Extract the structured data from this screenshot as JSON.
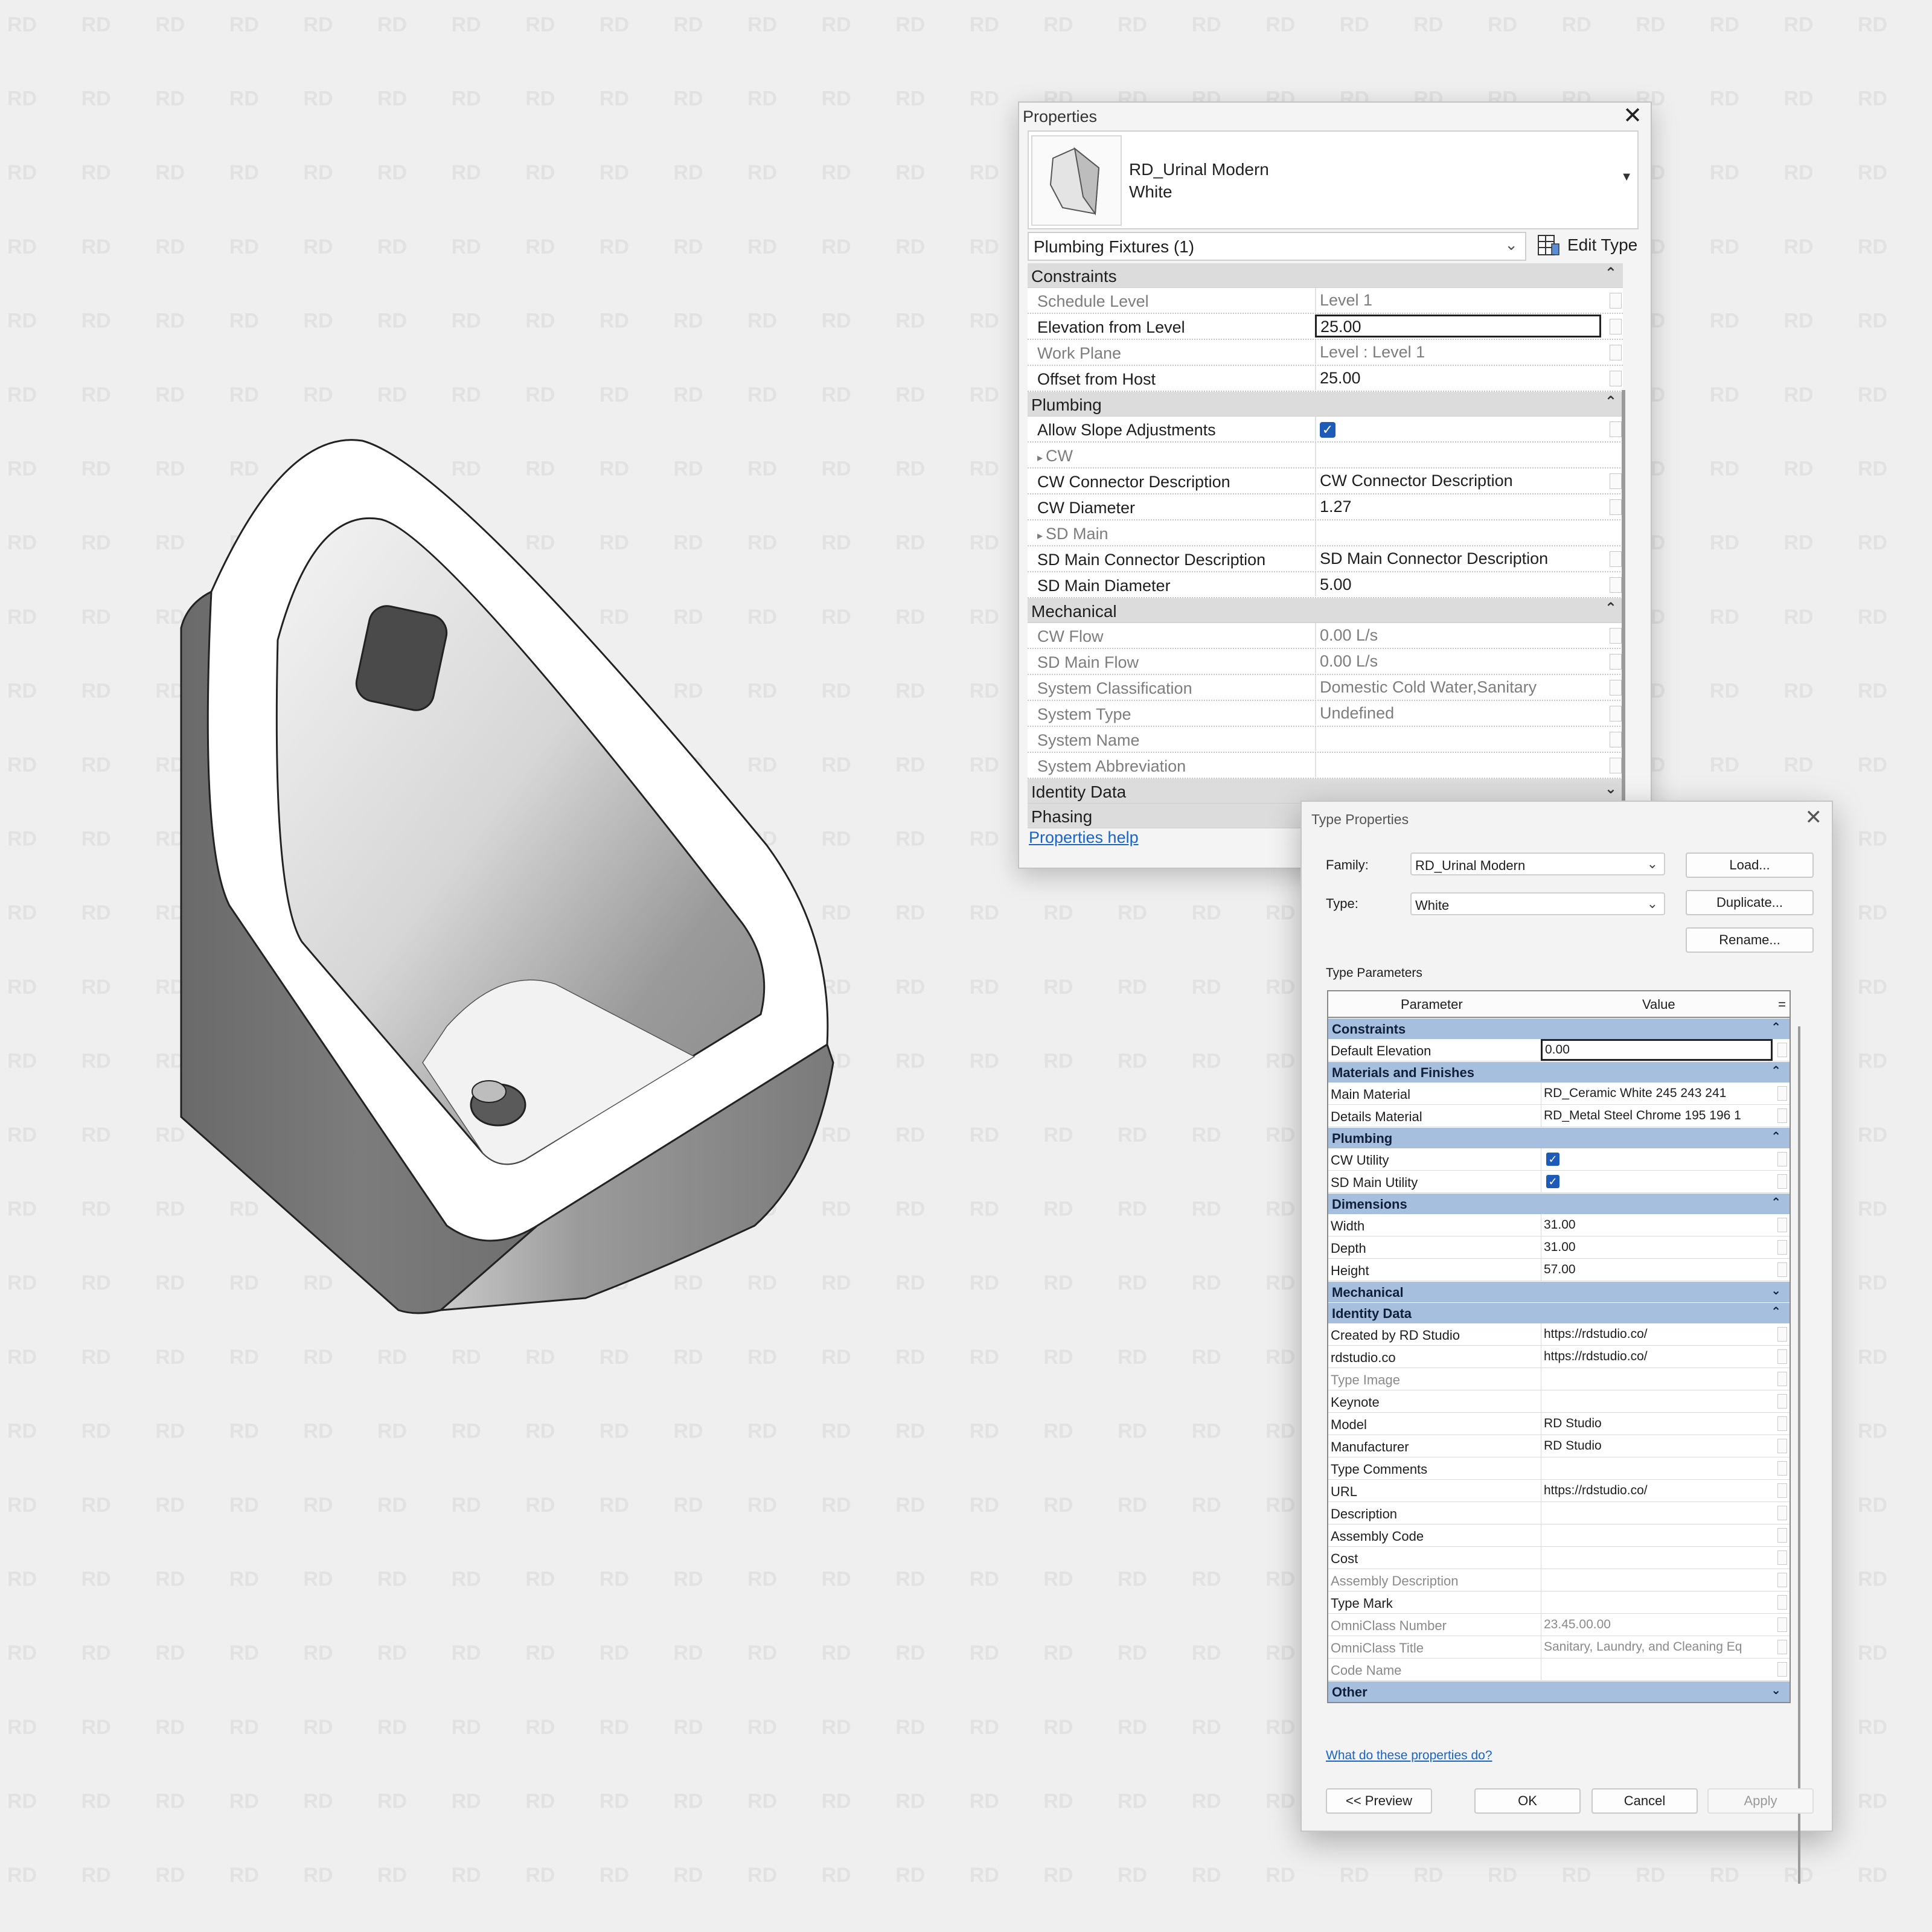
{
  "watermark": {
    "text": "RD"
  },
  "properties": {
    "title": "Properties",
    "close_icon": "close-icon",
    "type_selector": {
      "family": "RD_Urinal Modern",
      "type": "White"
    },
    "filter": "Plumbing Fixtures (1)",
    "edit_type_label": "Edit Type",
    "groups": [
      {
        "name": "Constraints",
        "expanded": true,
        "rows": [
          {
            "name": "Schedule Level",
            "value": "Level 1",
            "readonly": true
          },
          {
            "name": "Elevation from Level",
            "value": "25.00",
            "editing": true
          },
          {
            "name": "Work Plane",
            "value": "Level : Level 1",
            "readonly": true
          },
          {
            "name": "Offset from Host",
            "value": "25.00"
          }
        ]
      },
      {
        "name": "Plumbing",
        "expanded": true,
        "rows": [
          {
            "name": "Allow Slope Adjustments",
            "checkbox": true,
            "checked": true
          },
          {
            "name": "CW",
            "value": "",
            "subgroup": true,
            "readonly": true
          },
          {
            "name": "CW Connector Description",
            "value": "CW Connector Description"
          },
          {
            "name": "CW Diameter",
            "value": "1.27"
          },
          {
            "name": "SD Main",
            "value": "",
            "subgroup": true,
            "readonly": true
          },
          {
            "name": "SD Main Connector Description",
            "value": "SD Main Connector Description"
          },
          {
            "name": "SD Main Diameter",
            "value": "5.00"
          }
        ]
      },
      {
        "name": "Mechanical",
        "expanded": true,
        "rows": [
          {
            "name": "CW Flow",
            "value": "0.00 L/s",
            "readonly": true
          },
          {
            "name": "SD Main Flow",
            "value": "0.00 L/s",
            "readonly": true
          },
          {
            "name": "System Classification",
            "value": "Domestic Cold Water,Sanitary",
            "readonly": true
          },
          {
            "name": "System Type",
            "value": "Undefined",
            "readonly": true
          },
          {
            "name": "System Name",
            "value": "",
            "readonly": true
          },
          {
            "name": "System Abbreviation",
            "value": "",
            "readonly": true
          }
        ]
      },
      {
        "name": "Identity Data",
        "expanded": false,
        "rows": []
      },
      {
        "name": "Phasing",
        "expanded": false,
        "rows": []
      }
    ],
    "help_link": "Properties help"
  },
  "type_properties": {
    "title": "Type Properties",
    "family_label": "Family:",
    "family_value": "RD_Urinal Modern",
    "type_label": "Type:",
    "type_value": "White",
    "load_button": "Load...",
    "duplicate_button": "Duplicate...",
    "rename_button": "Rename...",
    "params_label": "Type Parameters",
    "col_parameter": "Parameter",
    "col_value": "Value",
    "col_equals": "=",
    "groups": [
      {
        "name": "Constraints",
        "expanded": true,
        "rows": [
          {
            "name": "Default Elevation",
            "value": "0.00",
            "editing": true
          }
        ]
      },
      {
        "name": "Materials and Finishes",
        "expanded": true,
        "rows": [
          {
            "name": "Main Material",
            "value": "RD_Ceramic White 245 243 241"
          },
          {
            "name": "Details Material",
            "value": "RD_Metal Steel Chrome 195 196 1"
          }
        ]
      },
      {
        "name": "Plumbing",
        "expanded": true,
        "rows": [
          {
            "name": "CW Utility",
            "checkbox": true,
            "checked": true
          },
          {
            "name": "SD Main Utility",
            "checkbox": true,
            "checked": true
          }
        ]
      },
      {
        "name": "Dimensions",
        "expanded": true,
        "rows": [
          {
            "name": "Width",
            "value": "31.00"
          },
          {
            "name": "Depth",
            "value": "31.00"
          },
          {
            "name": "Height",
            "value": "57.00"
          }
        ]
      },
      {
        "name": "Mechanical",
        "expanded": false,
        "rows": []
      },
      {
        "name": "Identity Data",
        "expanded": true,
        "rows": [
          {
            "name": "Created by RD Studio",
            "value": "https://rdstudio.co/"
          },
          {
            "name": "rdstudio.co",
            "value": "https://rdstudio.co/"
          },
          {
            "name": "Type Image",
            "value": "",
            "readonly": true
          },
          {
            "name": "Keynote",
            "value": ""
          },
          {
            "name": "Model",
            "value": "RD Studio"
          },
          {
            "name": "Manufacturer",
            "value": "RD Studio"
          },
          {
            "name": "Type Comments",
            "value": ""
          },
          {
            "name": "URL",
            "value": "https://rdstudio.co/"
          },
          {
            "name": "Description",
            "value": ""
          },
          {
            "name": "Assembly Code",
            "value": ""
          },
          {
            "name": "Cost",
            "value": ""
          },
          {
            "name": "Assembly Description",
            "value": "",
            "readonly": true
          },
          {
            "name": "Type Mark",
            "value": ""
          },
          {
            "name": "OmniClass Number",
            "value": "23.45.00.00",
            "readonly": true
          },
          {
            "name": "OmniClass Title",
            "value": "Sanitary, Laundry, and Cleaning Eq",
            "readonly": true
          },
          {
            "name": "Code Name",
            "value": "",
            "readonly": true
          }
        ]
      },
      {
        "name": "Other",
        "expanded": false,
        "rows": []
      }
    ],
    "help_link": "What do these properties do?",
    "preview_button": "<< Preview",
    "ok_button": "OK",
    "cancel_button": "Cancel",
    "apply_button": "Apply"
  }
}
